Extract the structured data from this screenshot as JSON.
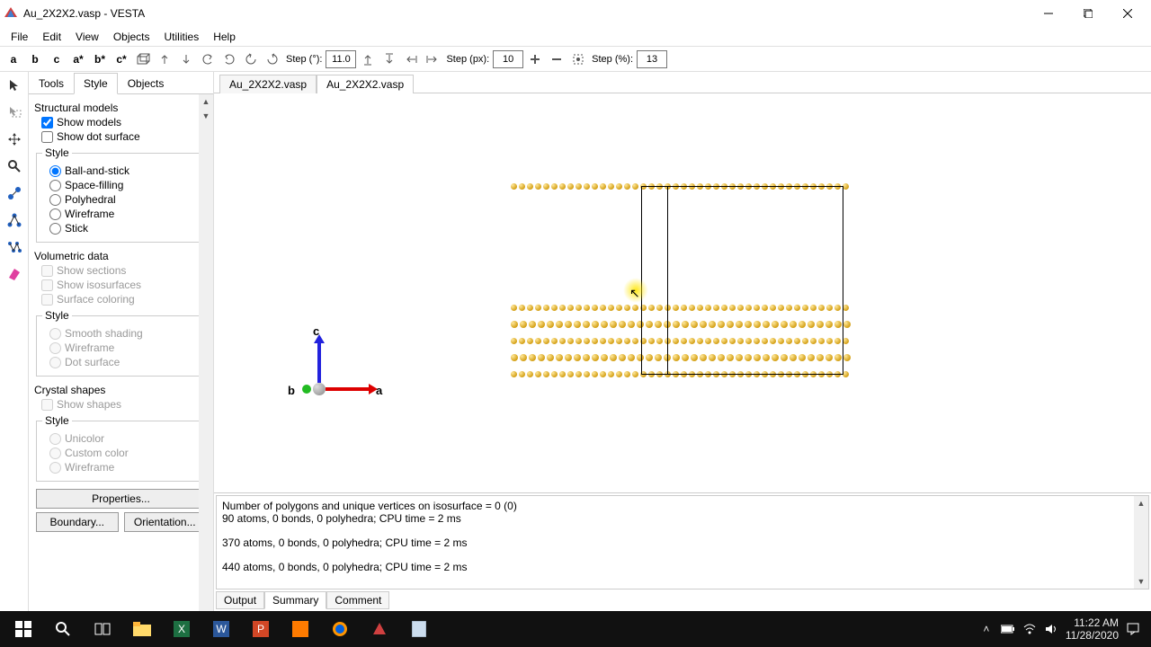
{
  "window": {
    "app_name": "VESTA",
    "title": "Au_2X2X2.vasp - VESTA"
  },
  "menu": {
    "file": "File",
    "edit": "Edit",
    "view": "View",
    "objects": "Objects",
    "utilities": "Utilities",
    "help": "Help"
  },
  "toolbar": {
    "a": "a",
    "b": "b",
    "c": "c",
    "astar": "a*",
    "bstar": "b*",
    "cstar": "c*",
    "step_deg_lbl": "Step (°):",
    "step_deg_val": "11.0",
    "step_px_lbl": "Step (px):",
    "step_px_val": "10",
    "step_pct_lbl": "Step (%):",
    "step_pct_val": "13"
  },
  "side": {
    "tabs": {
      "tools": "Tools",
      "style": "Style",
      "objects": "Objects"
    },
    "structural_models": "Structural models",
    "show_models": "Show models",
    "show_dot_surface": "Show dot surface",
    "style_legend": "Style",
    "ball_and_stick": "Ball-and-stick",
    "space_filling": "Space-filling",
    "polyhedral": "Polyhedral",
    "wireframe": "Wireframe",
    "stick": "Stick",
    "volumetric_data": "Volumetric data",
    "show_sections": "Show sections",
    "show_isosurfaces": "Show isosurfaces",
    "surface_coloring": "Surface coloring",
    "smooth_shading": "Smooth shading",
    "vd_wireframe": "Wireframe",
    "dot_surface": "Dot surface",
    "crystal_shapes": "Crystal shapes",
    "show_shapes": "Show shapes",
    "unicolor": "Unicolor",
    "custom_color": "Custom color",
    "cs_wireframe": "Wireframe",
    "properties": "Properties...",
    "boundary": "Boundary...",
    "orientation": "Orientation..."
  },
  "doc_tabs": {
    "t1": "Au_2X2X2.vasp",
    "t2": "Au_2X2X2.vasp"
  },
  "axis": {
    "a": "a",
    "b": "b",
    "c": "c"
  },
  "output": {
    "line1": "Number of polygons and unique vertices on isosurface = 0 (0)",
    "line2": "90 atoms, 0 bonds, 0 polyhedra; CPU time = 2 ms",
    "line3": "370 atoms, 0 bonds, 0 polyhedra; CPU time = 2 ms",
    "line4": "440 atoms, 0 bonds, 0 polyhedra; CPU time = 2 ms",
    "tabs": {
      "output": "Output",
      "summary": "Summary",
      "comment": "Comment"
    }
  },
  "tray": {
    "time": "11:22 AM",
    "date": "11/28/2020"
  }
}
